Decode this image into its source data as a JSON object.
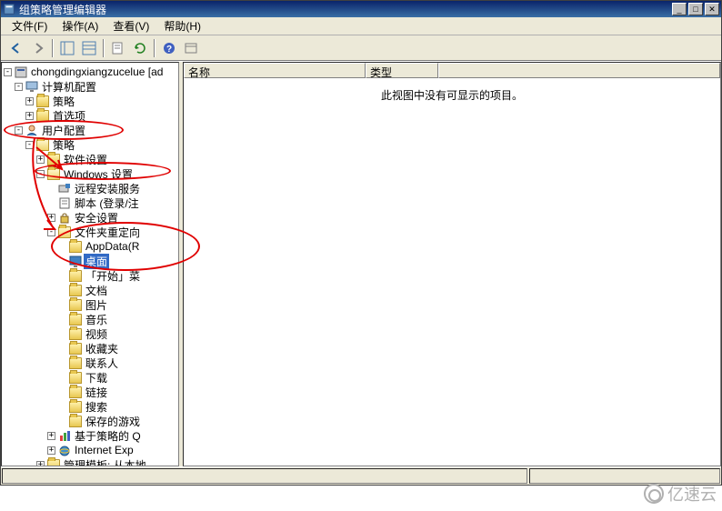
{
  "window": {
    "title": "组策略管理编辑器",
    "title_btns": {
      "min": "_",
      "max": "□",
      "close": "✕"
    }
  },
  "menu": {
    "file": "文件(F)",
    "action": "操作(A)",
    "view": "查看(V)",
    "help": "帮助(H)"
  },
  "tree": {
    "root": "chongdingxiangzucelue [ad",
    "computer_config": "计算机配置",
    "policy": "策略",
    "preferences": "首选项",
    "user_config": "用户配置",
    "software_settings": "软件设置",
    "windows_settings": "Windows 设置",
    "remote_install": "远程安装服务",
    "scripts": "脚本 (登录/注",
    "security_settings": "安全设置",
    "folder_redirect": "文件夹重定向",
    "appdata": "AppData(R",
    "desktop": "桌面",
    "startmenu": "「开始」菜",
    "documents": "文档",
    "pictures": "图片",
    "music": "音乐",
    "videos": "视频",
    "favorites": "收藏夹",
    "contacts": "联系人",
    "downloads": "下载",
    "links": "链接",
    "searches": "搜索",
    "saved_games": "保存的游戏",
    "policy_qos": "基于策略的 Q",
    "internet_exp": "Internet Exp",
    "admin_templates": "管理模板: 从本地"
  },
  "list": {
    "col_name": "名称",
    "col_type": "类型",
    "empty_message": "此视图中没有可显示的项目。"
  },
  "watermark": "亿速云"
}
